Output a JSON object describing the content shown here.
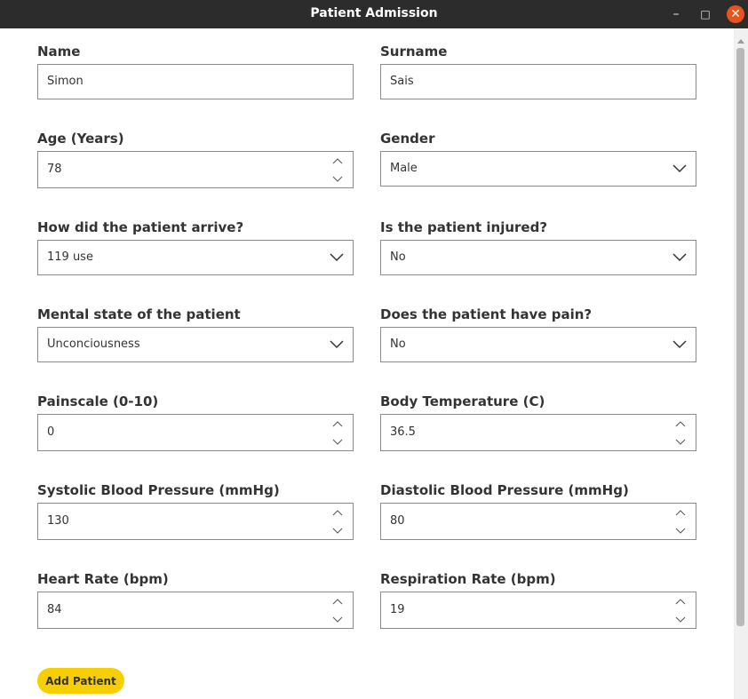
{
  "window": {
    "title": "Patient Admission",
    "minimize": "–",
    "maximize": "□",
    "close": "✕"
  },
  "form": {
    "name": {
      "label": "Name",
      "value": "Simon"
    },
    "surname": {
      "label": "Surname",
      "value": "Sais"
    },
    "age": {
      "label": "Age (Years)",
      "value": "78"
    },
    "gender": {
      "label": "Gender",
      "value": "Male"
    },
    "arrival": {
      "label": "How did the patient arrive?",
      "value": "119 use"
    },
    "injured": {
      "label": "Is the patient injured?",
      "value": "No"
    },
    "mental": {
      "label": "Mental state of the patient",
      "value": "Unconciousness"
    },
    "pain": {
      "label": "Does the patient have pain?",
      "value": "No"
    },
    "painscale": {
      "label": "Painscale (0-10)",
      "value": "0"
    },
    "temperature": {
      "label": "Body Temperature (C)",
      "value": "36.5"
    },
    "systolic": {
      "label": "Systolic Blood Pressure (mmHg)",
      "value": "130"
    },
    "diastolic": {
      "label": "Diastolic Blood Pressure (mmHg)",
      "value": "80"
    },
    "heart_rate": {
      "label": "Heart Rate (bpm)",
      "value": "84"
    },
    "respiration": {
      "label": "Respiration Rate (bpm)",
      "value": "19"
    },
    "submit_label": "Add Patient"
  },
  "colors": {
    "titlebar": "#2c2c2c",
    "close": "#e9541e",
    "accent": "#f7cf00",
    "border": "#8a8a8a"
  }
}
